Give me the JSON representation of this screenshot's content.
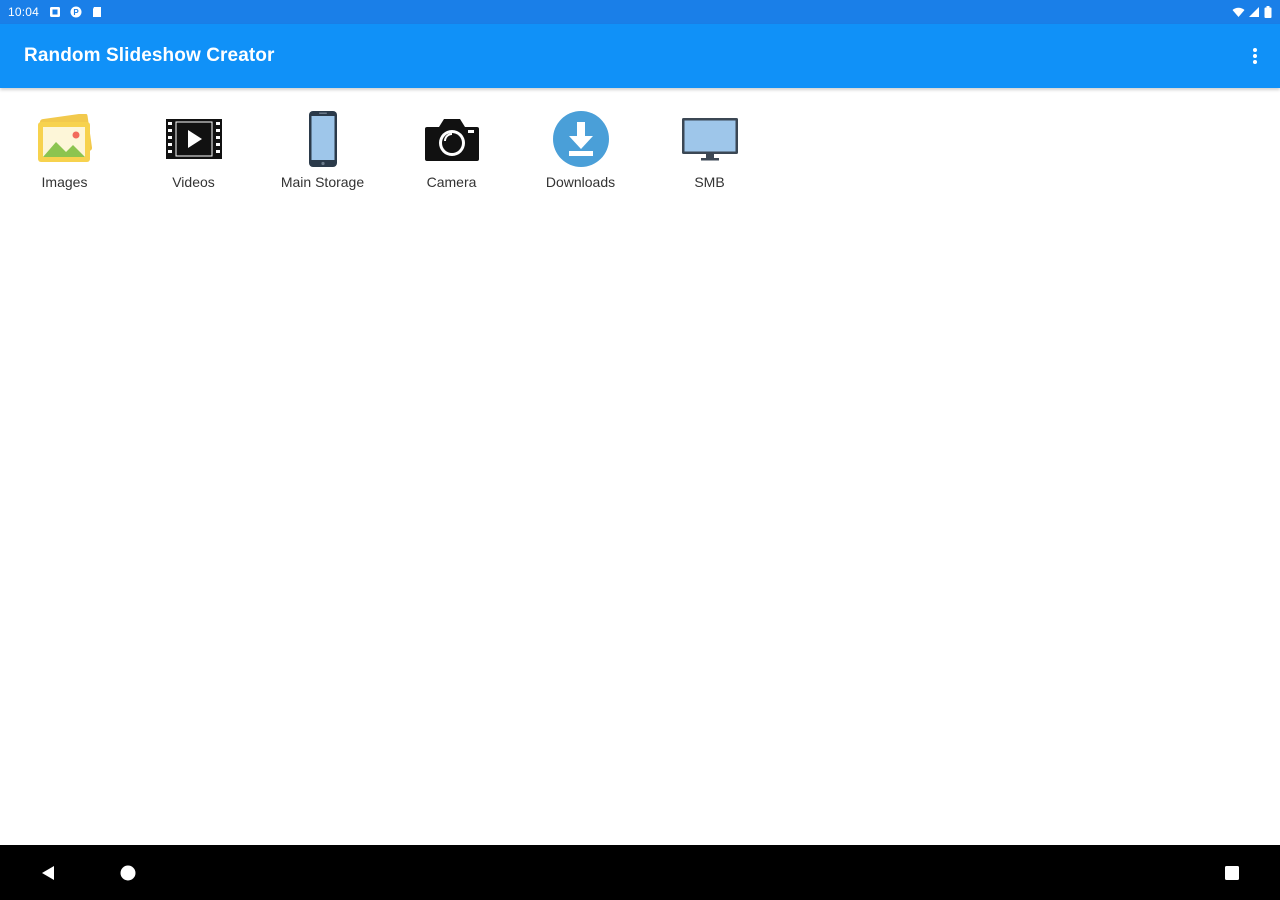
{
  "status_bar": {
    "time": "10:04",
    "icons": [
      "notification-square-icon",
      "p-badge-icon",
      "sd-card-icon"
    ],
    "right_icons": [
      "wifi-icon",
      "signal-icon",
      "battery-icon"
    ]
  },
  "app_bar": {
    "title": "Random Slideshow Creator",
    "menu_icon": "more-vert-icon"
  },
  "sources": [
    {
      "label": "Images",
      "icon": "images-icon"
    },
    {
      "label": "Videos",
      "icon": "videos-icon"
    },
    {
      "label": "Main Storage",
      "icon": "phone-storage-icon"
    },
    {
      "label": "Camera",
      "icon": "camera-icon"
    },
    {
      "label": "Downloads",
      "icon": "downloads-icon"
    },
    {
      "label": "SMB",
      "icon": "monitor-icon"
    }
  ],
  "nav_bar": {
    "back": "back-icon",
    "home": "home-icon",
    "recents": "recents-icon"
  },
  "colors": {
    "status_bar": "#1a7fe8",
    "app_bar": "#1091f8",
    "nav_bar": "#000000"
  }
}
